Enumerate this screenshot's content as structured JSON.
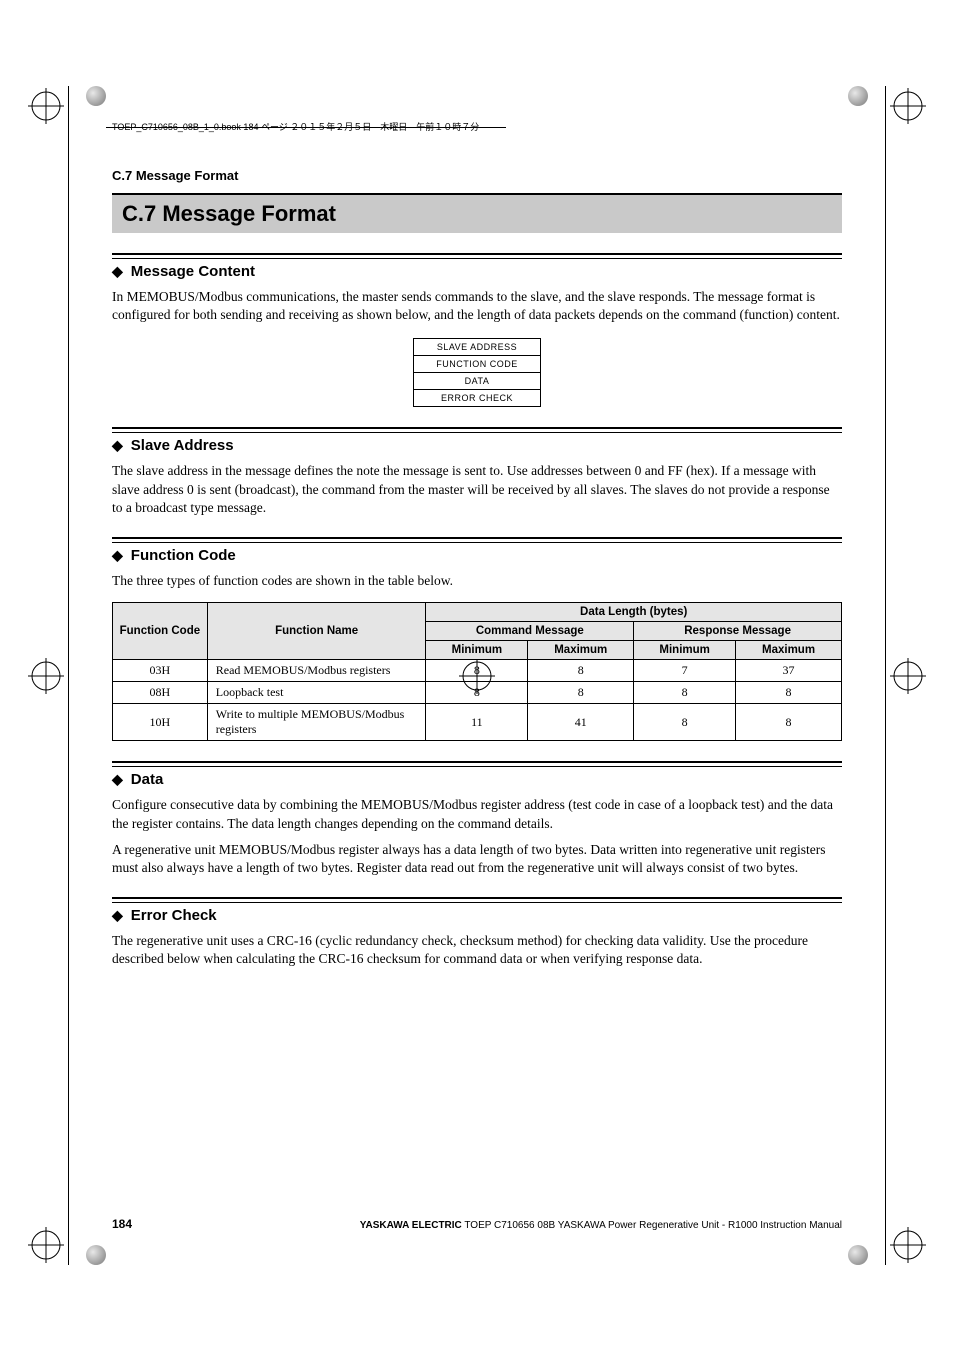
{
  "book_header": "TOEP_C710656_08B_1_0.book  184 ページ  ２０１５年２月５日　木曜日　午前１０時７分",
  "running_head": "C.7  Message Format",
  "section_title": "C.7   Message Format",
  "subsections": {
    "message_content": {
      "title": "Message Content",
      "body": "In MEMOBUS/Modbus communications, the master sends commands to the slave, and the slave responds. The message format is configured for both sending and receiving as shown below, and the length of data packets depends on the command (function) content."
    },
    "slave_address": {
      "title": "Slave Address",
      "body": "The slave address in the message defines the note the message is sent to. Use addresses between 0 and FF (hex). If a message with slave address 0 is sent (broadcast), the command from the master will be received by all slaves. The slaves do not provide a response to a broadcast type message."
    },
    "function_code": {
      "title": "Function Code",
      "body": "The three types of function codes are shown in the table below."
    },
    "data": {
      "title": "Data",
      "body1": "Configure consecutive data by combining the MEMOBUS/Modbus register address (test code in case of a loopback test) and the data the register contains. The data length changes depending on the command details.",
      "body2": "A regenerative unit MEMOBUS/Modbus register always has a data length of two bytes. Data written into regenerative unit registers must also always have a length of two bytes. Register data read out from the regenerative unit will always consist of two bytes."
    },
    "error_check": {
      "title": "Error Check",
      "body": "The regenerative unit uses a CRC-16 (cyclic redundancy check, checksum method) for checking data validity. Use the procedure described below when calculating the CRC-16 checksum for command data or when verifying response data."
    }
  },
  "message_format_table": [
    "SLAVE ADDRESS",
    "FUNCTION CODE",
    "DATA",
    "ERROR CHECK"
  ],
  "function_table": {
    "headers": {
      "code": "Function Code",
      "name": "Function Name",
      "data_length": "Data Length (bytes)",
      "command": "Command Message",
      "response": "Response Message",
      "minimum": "Minimum",
      "maximum": "Maximum"
    },
    "rows": [
      {
        "code": "03H",
        "name": "Read MEMOBUS/Modbus registers",
        "cmin": "8",
        "cmax": "8",
        "rmin": "7",
        "rmax": "37"
      },
      {
        "code": "08H",
        "name": "Loopback test",
        "cmin": "8",
        "cmax": "8",
        "rmin": "8",
        "rmax": "8"
      },
      {
        "code": "10H",
        "name": "Write to multiple MEMOBUS/Modbus registers",
        "cmin": "11",
        "cmax": "41",
        "rmin": "8",
        "rmax": "8"
      }
    ]
  },
  "footer": {
    "page_number": "184",
    "brand_bold": "YASKAWA ELECTRIC",
    "text": " TOEP C710656 08B YASKAWA Power Regenerative Unit - R1000 Instruction Manual"
  }
}
